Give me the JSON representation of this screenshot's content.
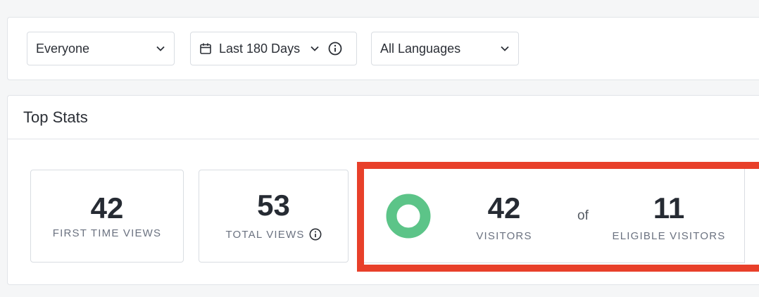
{
  "filters": {
    "audience": {
      "label": "Everyone"
    },
    "date_range": {
      "label": "Last 180 Days"
    },
    "language": {
      "label": "All Languages"
    }
  },
  "top_stats": {
    "title": "Top Stats",
    "first_time_views": {
      "value": "42",
      "label": "FIRST TIME VIEWS"
    },
    "total_views": {
      "value": "53",
      "label": "TOTAL VIEWS"
    },
    "visitors": {
      "value": "42",
      "label": "VISITORS"
    },
    "connector": "of",
    "eligible_visitors": {
      "value": "11",
      "label": "ELIGIBLE VISITORS"
    }
  },
  "colors": {
    "donut": "#5cc488",
    "highlight": "#e8402a"
  },
  "icons": {
    "audience_chevron": "chevron-down-icon",
    "calendar": "calendar-icon",
    "date_chevron": "chevron-down-icon",
    "date_info": "info-icon",
    "language_chevron": "chevron-down-icon",
    "total_views_info": "info-icon"
  }
}
